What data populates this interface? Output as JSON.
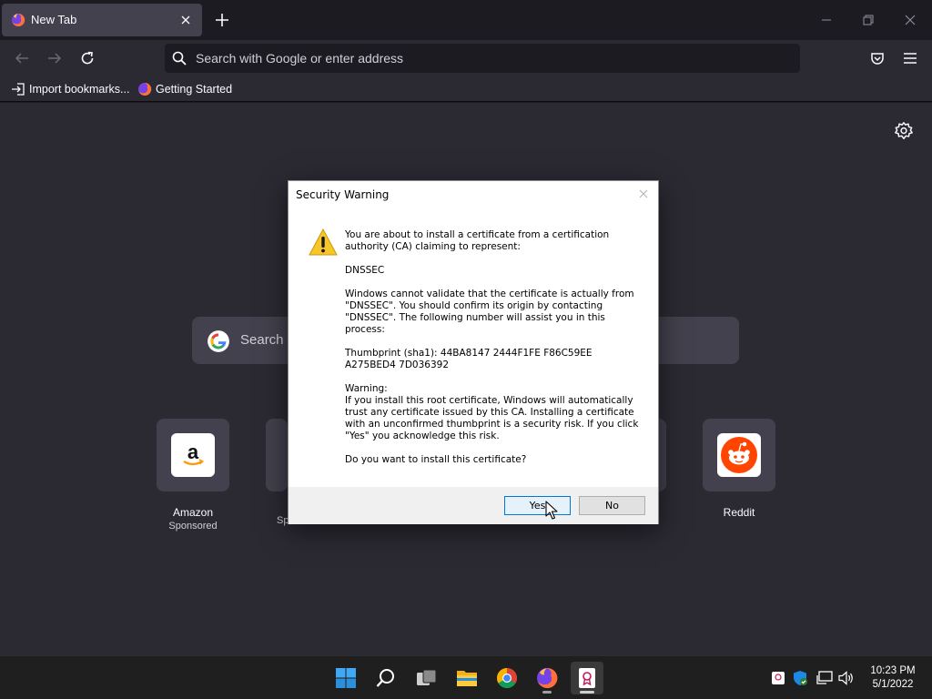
{
  "browser": {
    "tab": {
      "title": "New Tab"
    },
    "urlbar": {
      "placeholder": "Search with Google or enter address"
    },
    "bookmarks": [
      {
        "label": "Import bookmarks...",
        "icon": "import-icon"
      },
      {
        "label": "Getting Started",
        "icon": "firefox-icon"
      }
    ]
  },
  "newtab": {
    "search_placeholder": "Search w",
    "tiles": [
      {
        "name": "Amazon",
        "sub": "Sponsored",
        "icon": "amazon-logo"
      },
      {
        "name": "Reddit",
        "sub": "",
        "icon": "reddit-logo"
      }
    ],
    "partial_sub": "Sp"
  },
  "dialog": {
    "title": "Security Warning",
    "paragraphs": [
      "You are about to install a certificate from a certification authority (CA) claiming to represent:",
      "DNSSEC",
      "Windows cannot validate that the certificate is actually from \"DNSSEC\". You should confirm its origin by contacting \"DNSSEC\". The following number will assist you in this process:",
      "Thumbprint (sha1): 44BA8147 2444F1FE F86C59EE A275BED4 7D036392",
      "Warning:\nIf you install this root certificate, Windows will automatically trust any certificate issued by this CA. Installing a certificate with an unconfirmed thumbprint is a security risk. If you click \"Yes\" you acknowledge this risk.",
      "Do you want to install this certificate?"
    ],
    "yes_label": "Yes",
    "no_label": "No"
  },
  "taskbar": {
    "apps": [
      "start-icon",
      "search-icon",
      "task-view-icon",
      "file-explorer-icon",
      "chrome-icon",
      "firefox-icon",
      "certificate-app-icon"
    ],
    "clock": {
      "time": "10:23 PM",
      "date": "5/1/2022"
    }
  },
  "colors": {
    "accent": "#0078d7",
    "warning": "#f7c52c",
    "browser_bg": "#2b2a33"
  }
}
